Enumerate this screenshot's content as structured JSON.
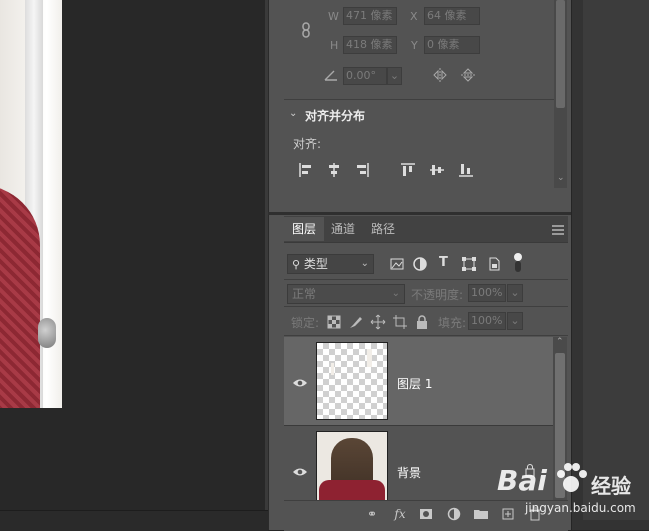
{
  "transform": {
    "w_label": "W",
    "w_value": "471 像素",
    "x_label": "X",
    "x_value": "64 像素",
    "h_label": "H",
    "h_value": "418 像素",
    "y_label": "Y",
    "y_value": "0 像素",
    "angle_value": "0.00°"
  },
  "align_section": {
    "title": "对齐并分布",
    "align_label": "对齐:"
  },
  "layers_panel": {
    "tabs": [
      "图层",
      "通道",
      "路径"
    ],
    "filter_value": "类型",
    "blend_mode": "正常",
    "opacity_label": "不透明度:",
    "opacity_value": "100%",
    "lock_label": "锁定:",
    "fill_label": "填充:",
    "fill_value": "100%",
    "layers": [
      {
        "name": "图层 1",
        "visible": true
      },
      {
        "name": "背景",
        "visible": true
      }
    ]
  },
  "watermark": {
    "brand": "Bai",
    "brand_tail": "经验",
    "url": "jingyan.baidu.com"
  },
  "colors": {
    "panel": "#535353",
    "canvas": "#282828",
    "sweater": "#8d2833"
  }
}
